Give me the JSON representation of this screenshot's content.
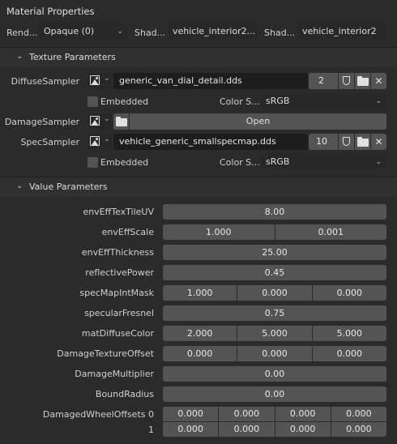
{
  "panel_title": "Material Properties",
  "top_row": {
    "render_label": "Rend...",
    "render_value": "Opaque (0)",
    "shader1_label": "Shad...",
    "shader1_value": "vehicle_interior2...",
    "shader2_label": "Shad...",
    "shader2_value": "vehicle_interior2"
  },
  "texture_section": {
    "header": "Texture Parameters",
    "diffuse": {
      "label": "DiffuseSampler",
      "file": "generic_van_dial_detail.dds",
      "users": "2",
      "embedded_label": "Embedded",
      "colorspace_label": "Color S...",
      "colorspace_value": "sRGB"
    },
    "damage": {
      "label": "DamageSampler",
      "open_label": "Open"
    },
    "spec": {
      "label": "SpecSampler",
      "file": "vehicle_generic_smallspecmap.dds",
      "users": "10",
      "embedded_label": "Embedded",
      "colorspace_label": "Color S...",
      "colorspace_value": "sRGB"
    }
  },
  "value_section": {
    "header": "Value Parameters",
    "rows": [
      {
        "label": "envEffTexTileUV",
        "values": [
          "8.00"
        ]
      },
      {
        "label": "envEffScale",
        "values": [
          "1.000",
          "0.001"
        ]
      },
      {
        "label": "envEffThickness",
        "values": [
          "25.00"
        ]
      },
      {
        "label": "reflectivePower",
        "values": [
          "0.45"
        ]
      },
      {
        "label": "specMapIntMask",
        "values": [
          "1.000",
          "0.000",
          "0.000"
        ]
      },
      {
        "label": "specularFresnel",
        "values": [
          "0.75"
        ]
      },
      {
        "label": "matDiffuseColor",
        "values": [
          "2.000",
          "5.000",
          "5.000"
        ]
      },
      {
        "label": "DamageTextureOffset",
        "values": [
          "0.000",
          "0.000",
          "0.000"
        ]
      },
      {
        "label": "DamageMultiplier",
        "values": [
          "0.00"
        ]
      },
      {
        "label": "BoundRadius",
        "values": [
          "0.00"
        ]
      }
    ],
    "wheel_offsets": {
      "label": "DamagedWheelOffsets 0",
      "label2": "1",
      "row0": [
        "0.000",
        "0.000",
        "0.000",
        "0.000"
      ],
      "row1": [
        "0.000",
        "0.000",
        "0.000",
        "0.000"
      ]
    }
  }
}
